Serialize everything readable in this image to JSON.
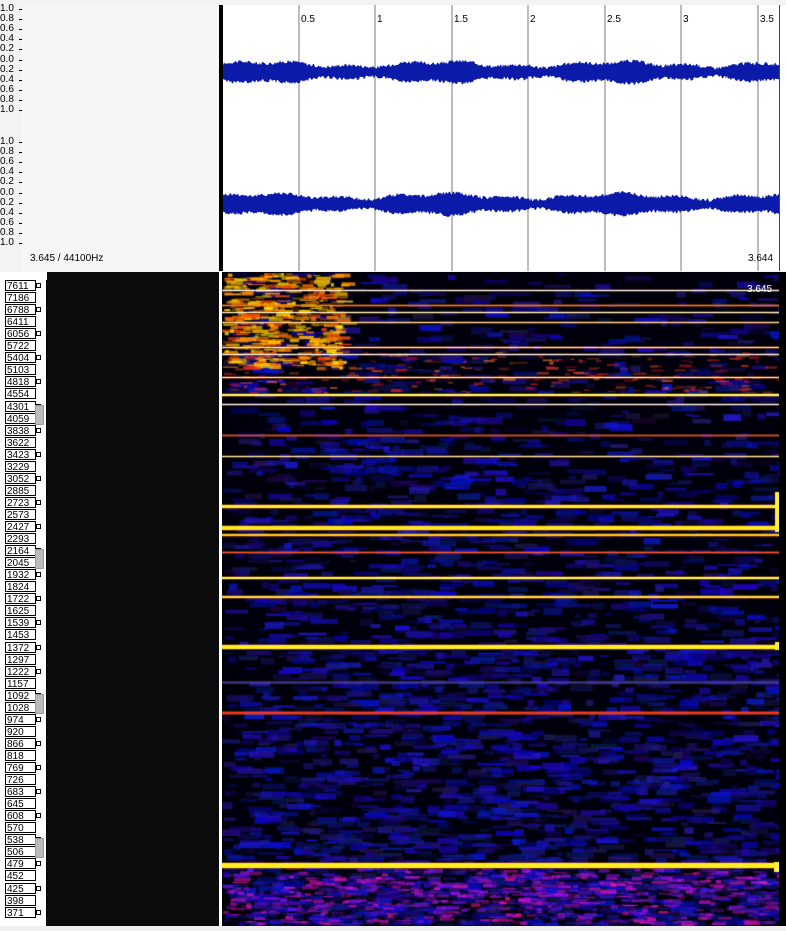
{
  "waveform": {
    "amplitude_labels_top": [
      "1.0",
      "0.8",
      "0.6",
      "0.4",
      "0.2",
      "0.0",
      "0.2",
      "0.4",
      "0.6",
      "0.8",
      "1.0"
    ],
    "amplitude_labels_bottom": [
      "1.0",
      "0.8",
      "0.6",
      "0.4",
      "0.2",
      "0.0",
      "0.2",
      "0.4",
      "0.6",
      "0.8",
      "1.0"
    ],
    "time_ticks": [
      "0.5",
      "1",
      "1.5",
      "2",
      "2.5",
      "3",
      "3.5"
    ],
    "status_text": "3.645 / 44100Hz",
    "end_time": "3.644",
    "channels": 2,
    "wave_color": "#0b1aa8"
  },
  "spectrogram": {
    "cursor_time": "3.645",
    "frequency_labels": [
      "7611",
      "7186",
      "6788",
      "6411",
      "6056",
      "5722",
      "5404",
      "5103",
      "4818",
      "4554",
      "4301",
      "4059",
      "3838",
      "3622",
      "3423",
      "3229",
      "3052",
      "2885",
      "2723",
      "2573",
      "2427",
      "2293",
      "2164",
      "2045",
      "1932",
      "1824",
      "1722",
      "1625",
      "1539",
      "1453",
      "1372",
      "1297",
      "1222",
      "1157",
      "1092",
      "1028",
      "974",
      "920",
      "866",
      "818",
      "769",
      "726",
      "683",
      "645",
      "608",
      "570",
      "538",
      "506",
      "479",
      "452",
      "425",
      "398",
      "371"
    ],
    "colors": {
      "background": "#000010",
      "low": "#1a1acc",
      "mid": "#cc1a1a",
      "high": "#ffee33"
    }
  }
}
